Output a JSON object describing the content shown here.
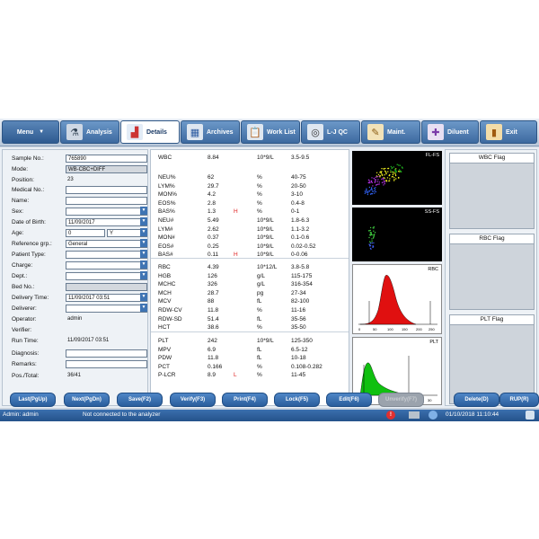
{
  "toolbar": {
    "menu_label": "Menu",
    "tabs": [
      {
        "label": "Analysis",
        "icon": "microscope-icon"
      },
      {
        "label": "Details",
        "icon": "histogram-icon"
      },
      {
        "label": "Archives",
        "icon": "table-icon"
      },
      {
        "label": "Work List",
        "icon": "clipboard-icon"
      },
      {
        "label": "L-J QC",
        "icon": "qc-icon"
      },
      {
        "label": "Maint.",
        "icon": "tools-icon"
      },
      {
        "label": "Diluent",
        "icon": "dropper-icon"
      },
      {
        "label": "Exit",
        "icon": "exit-door-icon"
      }
    ]
  },
  "sample": {
    "sample_no_label": "Sample No.:",
    "sample_no": "765890",
    "mode_label": "Mode:",
    "mode": "WB-CBC+DIFF",
    "position_label": "Position:",
    "position": "23",
    "medical_no_label": "Medical No.:",
    "medical_no": "",
    "name_label": "Name:",
    "name": "",
    "sex_label": "Sex:",
    "sex": "",
    "dob_label": "Date of Birth:",
    "dob": "11/09/2017",
    "age_label": "Age:",
    "age": "0",
    "age_unit": "Y",
    "ref_grp_label": "Reference grp.:",
    "ref_grp": "General",
    "patient_type_label": "Patient Type:",
    "patient_type": "",
    "charge_label": "Charge:",
    "charge": "",
    "dept_label": "Dept.:",
    "dept": "",
    "bed_no_label": "Bed No.:",
    "bed_no": "",
    "delivery_time_label": "Delivery Time:",
    "delivery_time": "11/09/2017 03:51",
    "deliverer_label": "Deliverer:",
    "deliverer": "",
    "operator_label": "Operator:",
    "operator": "admin",
    "verifier_label": "Verifier:",
    "verifier": "",
    "run_time_label": "Run Time:",
    "run_time": "11/09/2017 03:51",
    "diagnosis_label": "Diagnosis:",
    "diagnosis": "",
    "remarks_label": "Remarks:",
    "remarks": "",
    "pos_total_label": "Pos./Total:",
    "pos_total": "36/41"
  },
  "results": {
    "wbc": [
      {
        "name": "WBC",
        "value": "8.84",
        "flag": "",
        "unit": "10*9/L",
        "range": "3.5-9.5"
      }
    ],
    "diff": [
      {
        "name": "NEU%",
        "value": "62",
        "flag": "",
        "unit": "%",
        "range": "40-75"
      },
      {
        "name": "LYM%",
        "value": "29.7",
        "flag": "",
        "unit": "%",
        "range": "20-50"
      },
      {
        "name": "MON%",
        "value": "4.2",
        "flag": "",
        "unit": "%",
        "range": "3-10"
      },
      {
        "name": "EOS%",
        "value": "2.8",
        "flag": "",
        "unit": "%",
        "range": "0.4-8"
      },
      {
        "name": "BAS%",
        "value": "1.3",
        "flag": "H",
        "unit": "%",
        "range": "0-1"
      },
      {
        "name": "NEU#",
        "value": "5.49",
        "flag": "",
        "unit": "10*9/L",
        "range": "1.8-6.3"
      },
      {
        "name": "LYM#",
        "value": "2.62",
        "flag": "",
        "unit": "10*9/L",
        "range": "1.1-3.2"
      },
      {
        "name": "MON#",
        "value": "0.37",
        "flag": "",
        "unit": "10*9/L",
        "range": "0.1-0.6"
      },
      {
        "name": "EOS#",
        "value": "0.25",
        "flag": "",
        "unit": "10*9/L",
        "range": "0.02-0.52"
      },
      {
        "name": "BAS#",
        "value": "0.11",
        "flag": "H",
        "unit": "10*9/L",
        "range": "0-0.06"
      }
    ],
    "rbc": [
      {
        "name": "RBC",
        "value": "4.39",
        "flag": "",
        "unit": "10*12/L",
        "range": "3.8-5.8"
      },
      {
        "name": "HGB",
        "value": "126",
        "flag": "",
        "unit": "g/L",
        "range": "115-175"
      },
      {
        "name": "MCHC",
        "value": "326",
        "flag": "",
        "unit": "g/L",
        "range": "316-354"
      },
      {
        "name": "MCH",
        "value": "28.7",
        "flag": "",
        "unit": "pg",
        "range": "27-34"
      },
      {
        "name": "MCV",
        "value": "88",
        "flag": "",
        "unit": "fL",
        "range": "82-100"
      },
      {
        "name": "RDW-CV",
        "value": "11.8",
        "flag": "",
        "unit": "%",
        "range": "11-16"
      },
      {
        "name": "RDW-SD",
        "value": "51.4",
        "flag": "",
        "unit": "fL",
        "range": "35-56"
      },
      {
        "name": "HCT",
        "value": "38.6",
        "flag": "",
        "unit": "%",
        "range": "35-50"
      }
    ],
    "plt": [
      {
        "name": "PLT",
        "value": "242",
        "flag": "",
        "unit": "10*9/L",
        "range": "125-350"
      },
      {
        "name": "MPV",
        "value": "6.9",
        "flag": "",
        "unit": "fL",
        "range": "6.5-12"
      },
      {
        "name": "PDW",
        "value": "11.8",
        "flag": "",
        "unit": "fL",
        "range": "10-18"
      },
      {
        "name": "PCT",
        "value": "0.166",
        "flag": "",
        "unit": "%",
        "range": "0.108-0.282"
      },
      {
        "name": "P-LCR",
        "value": "8.9",
        "flag": "L",
        "unit": "%",
        "range": "11-45"
      }
    ]
  },
  "plots": {
    "fl_fs_label": "FL-FS",
    "ss_fs_label": "SS-FS",
    "rbc_label": "RBC",
    "plt_label": "PLT",
    "rbc_ticks": [
      "0",
      "50",
      "100",
      "150",
      "200",
      "250"
    ],
    "plt_ticks": [
      "0",
      "5",
      "10",
      "15",
      "20",
      "25",
      "30"
    ],
    "rbc_color": "#e01010",
    "plt_color": "#10c010"
  },
  "flags": {
    "wbc_flag_title": "WBC Flag",
    "rbc_flag_title": "RBC Flag",
    "plt_flag_title": "PLT Flag"
  },
  "buttons": {
    "last": "Last(PgUp)",
    "next": "Next(PgDn)",
    "save": "Save(F2)",
    "verify": "Verify(F3)",
    "print": "Print(F4)",
    "lock": "Lock(F5)",
    "edit": "Edit(F6)",
    "disabled": "Unverify(F7)",
    "delete": "Delete(D)",
    "rup": "RUP(R)"
  },
  "status": {
    "user": "Admin: admin",
    "connection": "Not connected to the analyzer",
    "datetime": "01/10/2018 11:10:44"
  }
}
